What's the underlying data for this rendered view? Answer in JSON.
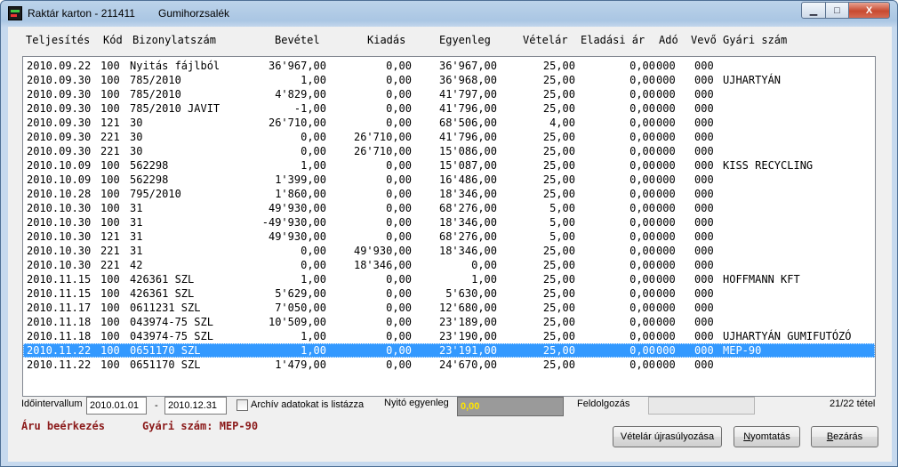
{
  "window": {
    "title": "Raktár karton - 211411",
    "subtitle": "Gumihorzsalék",
    "controls": {
      "minimize": "▁",
      "maximize": "□",
      "close": "X"
    }
  },
  "columns": {
    "date": "Teljesítés",
    "kod": "Kód",
    "biz": "Bizonylatszám",
    "bev": "Bevétel",
    "kia": "Kiadás",
    "egy": "Egyenleg",
    "vet": "Vételár",
    "ela": "Eladási ár",
    "ado": "Adó",
    "vev": "Vevő",
    "gyr": "Gyári szám"
  },
  "rows": [
    {
      "date": "2010.09.22",
      "kod": "100",
      "biz": "Nyitás fájlból",
      "bev": "36'967,00",
      "kia": "0,00",
      "egy": "36'967,00",
      "vet": "25,00",
      "ela": "0,00",
      "ado": "000",
      "vev": "000",
      "gyr": ""
    },
    {
      "date": "2010.09.30",
      "kod": "100",
      "biz": "785/2010",
      "bev": "1,00",
      "kia": "0,00",
      "egy": "36'968,00",
      "vet": "25,00",
      "ela": "0,00",
      "ado": "000",
      "vev": "000",
      "gyr": "UJHARTYÁN"
    },
    {
      "date": "2010.09.30",
      "kod": "100",
      "biz": "785/2010",
      "bev": "4'829,00",
      "kia": "0,00",
      "egy": "41'797,00",
      "vet": "25,00",
      "ela": "0,00",
      "ado": "000",
      "vev": "000",
      "gyr": ""
    },
    {
      "date": "2010.09.30",
      "kod": "100",
      "biz": "785/2010 JAVIT",
      "bev": "-1,00",
      "kia": "0,00",
      "egy": "41'796,00",
      "vet": "25,00",
      "ela": "0,00",
      "ado": "000",
      "vev": "000",
      "gyr": ""
    },
    {
      "date": "2010.09.30",
      "kod": "121",
      "biz": "30",
      "bev": "26'710,00",
      "kia": "0,00",
      "egy": "68'506,00",
      "vet": "4,00",
      "ela": "0,00",
      "ado": "000",
      "vev": "000",
      "gyr": ""
    },
    {
      "date": "2010.09.30",
      "kod": "221",
      "biz": "30",
      "bev": "0,00",
      "kia": "26'710,00",
      "egy": "41'796,00",
      "vet": "25,00",
      "ela": "0,00",
      "ado": "000",
      "vev": "000",
      "gyr": ""
    },
    {
      "date": "2010.09.30",
      "kod": "221",
      "biz": "30",
      "bev": "0,00",
      "kia": "26'710,00",
      "egy": "15'086,00",
      "vet": "25,00",
      "ela": "0,00",
      "ado": "000",
      "vev": "000",
      "gyr": ""
    },
    {
      "date": "2010.10.09",
      "kod": "100",
      "biz": "562298",
      "bev": "1,00",
      "kia": "0,00",
      "egy": "15'087,00",
      "vet": "25,00",
      "ela": "0,00",
      "ado": "000",
      "vev": "000",
      "gyr": "KISS RECYCLING"
    },
    {
      "date": "2010.10.09",
      "kod": "100",
      "biz": "562298",
      "bev": "1'399,00",
      "kia": "0,00",
      "egy": "16'486,00",
      "vet": "25,00",
      "ela": "0,00",
      "ado": "000",
      "vev": "000",
      "gyr": ""
    },
    {
      "date": "2010.10.28",
      "kod": "100",
      "biz": "795/2010",
      "bev": "1'860,00",
      "kia": "0,00",
      "egy": "18'346,00",
      "vet": "25,00",
      "ela": "0,00",
      "ado": "000",
      "vev": "000",
      "gyr": ""
    },
    {
      "date": "2010.10.30",
      "kod": "100",
      "biz": "31",
      "bev": "49'930,00",
      "kia": "0,00",
      "egy": "68'276,00",
      "vet": "5,00",
      "ela": "0,00",
      "ado": "000",
      "vev": "000",
      "gyr": ""
    },
    {
      "date": "2010.10.30",
      "kod": "100",
      "biz": "31",
      "bev": "-49'930,00",
      "kia": "0,00",
      "egy": "18'346,00",
      "vet": "5,00",
      "ela": "0,00",
      "ado": "000",
      "vev": "000",
      "gyr": ""
    },
    {
      "date": "2010.10.30",
      "kod": "121",
      "biz": "31",
      "bev": "49'930,00",
      "kia": "0,00",
      "egy": "68'276,00",
      "vet": "5,00",
      "ela": "0,00",
      "ado": "000",
      "vev": "000",
      "gyr": ""
    },
    {
      "date": "2010.10.30",
      "kod": "221",
      "biz": "31",
      "bev": "0,00",
      "kia": "49'930,00",
      "egy": "18'346,00",
      "vet": "25,00",
      "ela": "0,00",
      "ado": "000",
      "vev": "000",
      "gyr": ""
    },
    {
      "date": "2010.10.30",
      "kod": "221",
      "biz": "42",
      "bev": "0,00",
      "kia": "18'346,00",
      "egy": "0,00",
      "vet": "25,00",
      "ela": "0,00",
      "ado": "000",
      "vev": "000",
      "gyr": ""
    },
    {
      "date": "2010.11.15",
      "kod": "100",
      "biz": "426361 SZL",
      "bev": "1,00",
      "kia": "0,00",
      "egy": "1,00",
      "vet": "25,00",
      "ela": "0,00",
      "ado": "000",
      "vev": "000",
      "gyr": "HOFFMANN KFT"
    },
    {
      "date": "2010.11.15",
      "kod": "100",
      "biz": "426361 SZL",
      "bev": "5'629,00",
      "kia": "0,00",
      "egy": "5'630,00",
      "vet": "25,00",
      "ela": "0,00",
      "ado": "000",
      "vev": "000",
      "gyr": ""
    },
    {
      "date": "2010.11.17",
      "kod": "100",
      "biz": "0611231 SZL",
      "bev": "7'050,00",
      "kia": "0,00",
      "egy": "12'680,00",
      "vet": "25,00",
      "ela": "0,00",
      "ado": "000",
      "vev": "000",
      "gyr": ""
    },
    {
      "date": "2010.11.18",
      "kod": "100",
      "biz": "043974-75 SZL",
      "bev": "10'509,00",
      "kia": "0,00",
      "egy": "23'189,00",
      "vet": "25,00",
      "ela": "0,00",
      "ado": "000",
      "vev": "000",
      "gyr": ""
    },
    {
      "date": "2010.11.18",
      "kod": "100",
      "biz": "043974-75 SZL",
      "bev": "1,00",
      "kia": "0,00",
      "egy": "23'190,00",
      "vet": "25,00",
      "ela": "0,00",
      "ado": "000",
      "vev": "000",
      "gyr": "UJHARTYÁN GUMIFUTÓZÓ"
    },
    {
      "date": "2010.11.22",
      "kod": "100",
      "biz": "0651170 SZL",
      "bev": "1,00",
      "kia": "0,00",
      "egy": "23'191,00",
      "vet": "25,00",
      "ela": "0,00",
      "ado": "000",
      "vev": "000",
      "gyr": "MEP-90",
      "selected": true
    },
    {
      "date": "2010.11.22",
      "kod": "100",
      "biz": "0651170 SZL",
      "bev": "1'479,00",
      "kia": "0,00",
      "egy": "24'670,00",
      "vet": "25,00",
      "ela": "0,00",
      "ado": "000",
      "vev": "000",
      "gyr": ""
    }
  ],
  "filters": {
    "interval_label": "Időintervallum",
    "date_from": "2010.01.01",
    "separator": "-",
    "date_to": "2010.12.31",
    "archive_label": "Archív adatokat is listázza",
    "opening_label": "Nyitó egyenleg",
    "opening_value": "0,00",
    "processing_label": "Feldolgozás",
    "processing_progress": 0,
    "count_text": "21/22 tétel"
  },
  "status": {
    "left": "Áru beérkezés",
    "right": "Gyári szám: MEP-90"
  },
  "buttons": {
    "recalc": "Vételár újrasúlyozása",
    "print_u": "N",
    "print_rest": "yomtatás",
    "close_u": "B",
    "close_rest": "ezárás"
  }
}
